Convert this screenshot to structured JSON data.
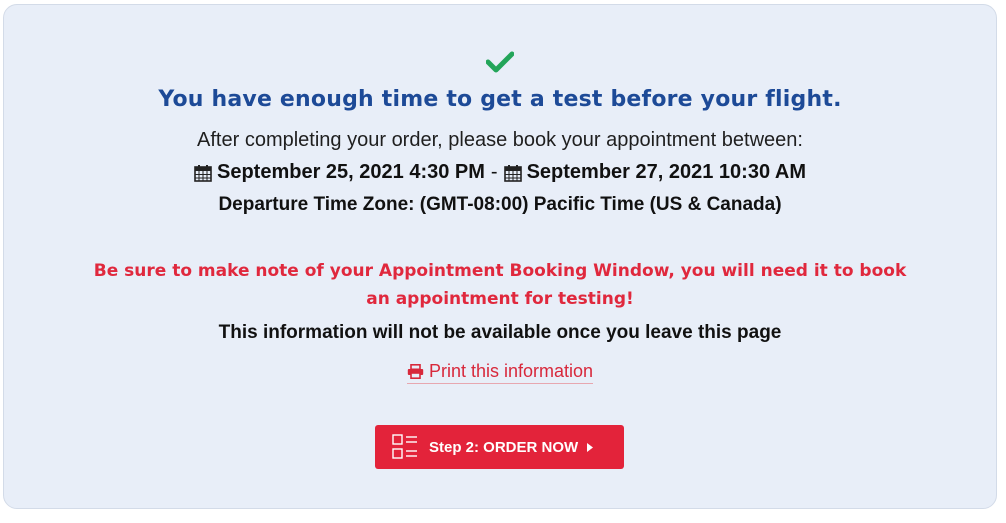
{
  "status": {
    "icon": "checkmark-icon",
    "icon_color": "#23a55a",
    "headline": "You have enough time to get a test before your flight."
  },
  "booking_window": {
    "intro": "After completing your order, please book your appointment between:",
    "start": "September 25, 2021 4:30 PM",
    "separator": "-",
    "end": "September 27, 2021 10:30 AM",
    "timezone": "Departure Time Zone: (GMT-08:00) Pacific Time (US & Canada)"
  },
  "warning": {
    "text": "Be sure to make note of your Appointment Booking Window, you will need it to book an appointment for testing!",
    "color": "#e0283d"
  },
  "notice": "This information will not be available once you leave this page",
  "print_link": {
    "label": "Print this information",
    "icon": "printer-icon"
  },
  "order_button": {
    "label": "Step 2: ORDER NOW",
    "icon": "checklist-icon",
    "arrow_icon": "caret-right-icon",
    "color": "#e3233a"
  },
  "colors": {
    "headline": "#1d4a97",
    "card_background": "#e8eef8"
  }
}
